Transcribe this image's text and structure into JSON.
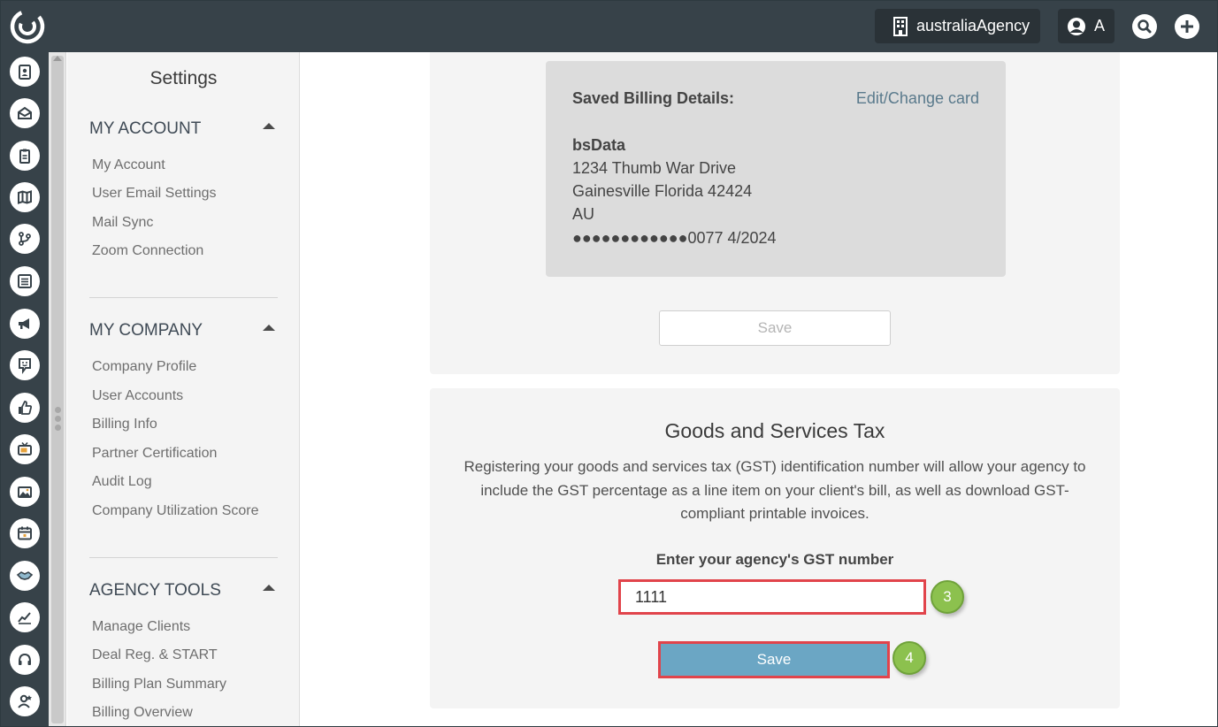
{
  "topbar": {
    "agency_name": "australiaAgency",
    "user_initial": "A"
  },
  "rail": {
    "icons": [
      "contacts-icon",
      "inbox-icon",
      "clipboard-icon",
      "map-icon",
      "branch-icon",
      "list-icon",
      "megaphone-icon",
      "chat-smile-icon",
      "thumbs-up-icon",
      "tv-icon",
      "image-icon",
      "calendar-icon",
      "handshake-icon",
      "chart-icon",
      "headset-icon",
      "user-star-icon"
    ]
  },
  "settings": {
    "title": "Settings",
    "my_account": {
      "heading": "MY ACCOUNT",
      "items": [
        "My Account",
        "User Email Settings",
        "Mail Sync",
        "Zoom Connection"
      ]
    },
    "my_company": {
      "heading": "MY COMPANY",
      "items": [
        "Company Profile",
        "User Accounts",
        "Billing Info",
        "Partner Certification",
        "Audit Log",
        "Company Utilization Score"
      ]
    },
    "agency_tools": {
      "heading": "AGENCY TOOLS",
      "items": [
        "Manage Clients",
        "Deal Reg. & START",
        "Billing Plan Summary",
        "Billing Overview"
      ]
    }
  },
  "billing": {
    "heading": "Saved Billing Details:",
    "edit_link": "Edit/Change card",
    "name": "bsData",
    "address_line1": "1234 Thumb War Drive",
    "address_line2": "Gainesville Florida 42424",
    "country": "AU",
    "card": "●●●●●●●●●●●●0077 4/2024",
    "save_label": "Save"
  },
  "gst": {
    "title": "Goods and Services Tax",
    "description": "Registering your goods and services tax (GST) identification number will allow your agency to include the GST percentage as a line item on your client's bill, as well as download GST-compliant printable invoices.",
    "input_label": "Enter your agency's GST number",
    "input_value": "1111",
    "save_label": "Save",
    "step_input": "3",
    "step_save": "4"
  }
}
